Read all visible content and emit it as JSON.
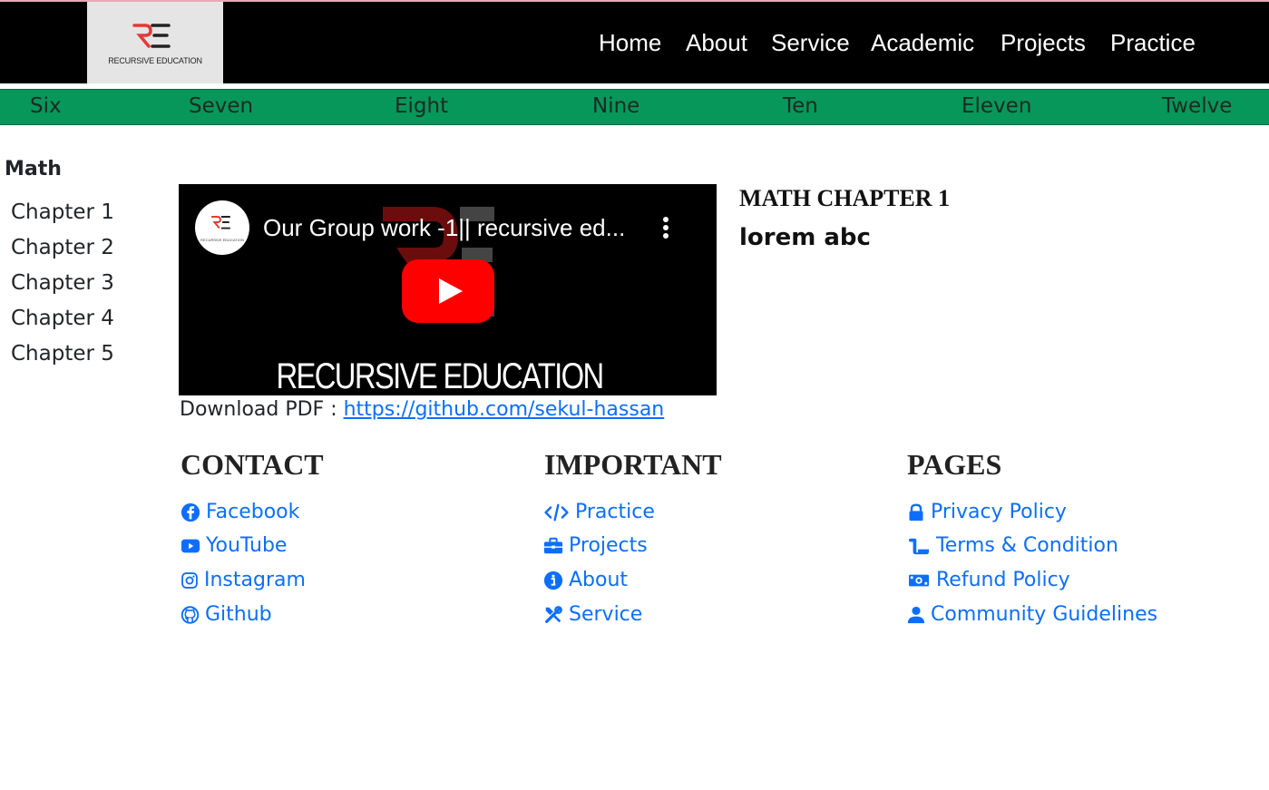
{
  "brand": {
    "logo_text": "RECURSIVE EDUCATION",
    "accent": "#e53935"
  },
  "nav": {
    "items": [
      "Home",
      "About",
      "Service",
      "Academic",
      "Projects",
      "Practice"
    ]
  },
  "grades": [
    "Six",
    "Seven",
    "Eight",
    "Nine",
    "Ten",
    "Eleven",
    "Twelve"
  ],
  "sidebar": {
    "title": "Math",
    "chapters": [
      "Chapter 1",
      "Chapter 2",
      "Chapter 3",
      "Chapter 4",
      "Chapter 5"
    ]
  },
  "video": {
    "title": "Our Group work -1|| recursive ed...",
    "caption": "RECURSIVE EDUCATION",
    "avatar_text": "RECURSIVE EDUCATION"
  },
  "download": {
    "label": "Download PDF : ",
    "link": "https://github.com/sekul-hassan"
  },
  "chapter_info": {
    "title": "MATH CHAPTER 1",
    "body": "lorem abc"
  },
  "footer": {
    "contact": {
      "heading": "CONTACT",
      "links": [
        {
          "label": "Facebook",
          "icon": "facebook-icon"
        },
        {
          "label": "YouTube",
          "icon": "youtube-icon"
        },
        {
          "label": "Instagram",
          "icon": "instagram-icon"
        },
        {
          "label": "Github",
          "icon": "github-icon"
        }
      ]
    },
    "important": {
      "heading": "IMPORTANT",
      "links": [
        {
          "label": "Practice",
          "icon": "code-icon"
        },
        {
          "label": "Projects",
          "icon": "briefcase-icon"
        },
        {
          "label": "About",
          "icon": "info-icon"
        },
        {
          "label": "Service",
          "icon": "tools-icon"
        }
      ]
    },
    "pages": {
      "heading": "PAGES",
      "links": [
        {
          "label": "Privacy Policy",
          "icon": "lock-icon"
        },
        {
          "label": "Terms & Condition",
          "icon": "scroll-icon"
        },
        {
          "label": "Refund Policy",
          "icon": "money-icon"
        },
        {
          "label": "Community Guidelines",
          "icon": "user-icon"
        }
      ]
    }
  },
  "colors": {
    "header_bg": "#000000",
    "grade_bar": "#07975a",
    "link": "#0d6efd",
    "play_button": "#ff0000"
  }
}
